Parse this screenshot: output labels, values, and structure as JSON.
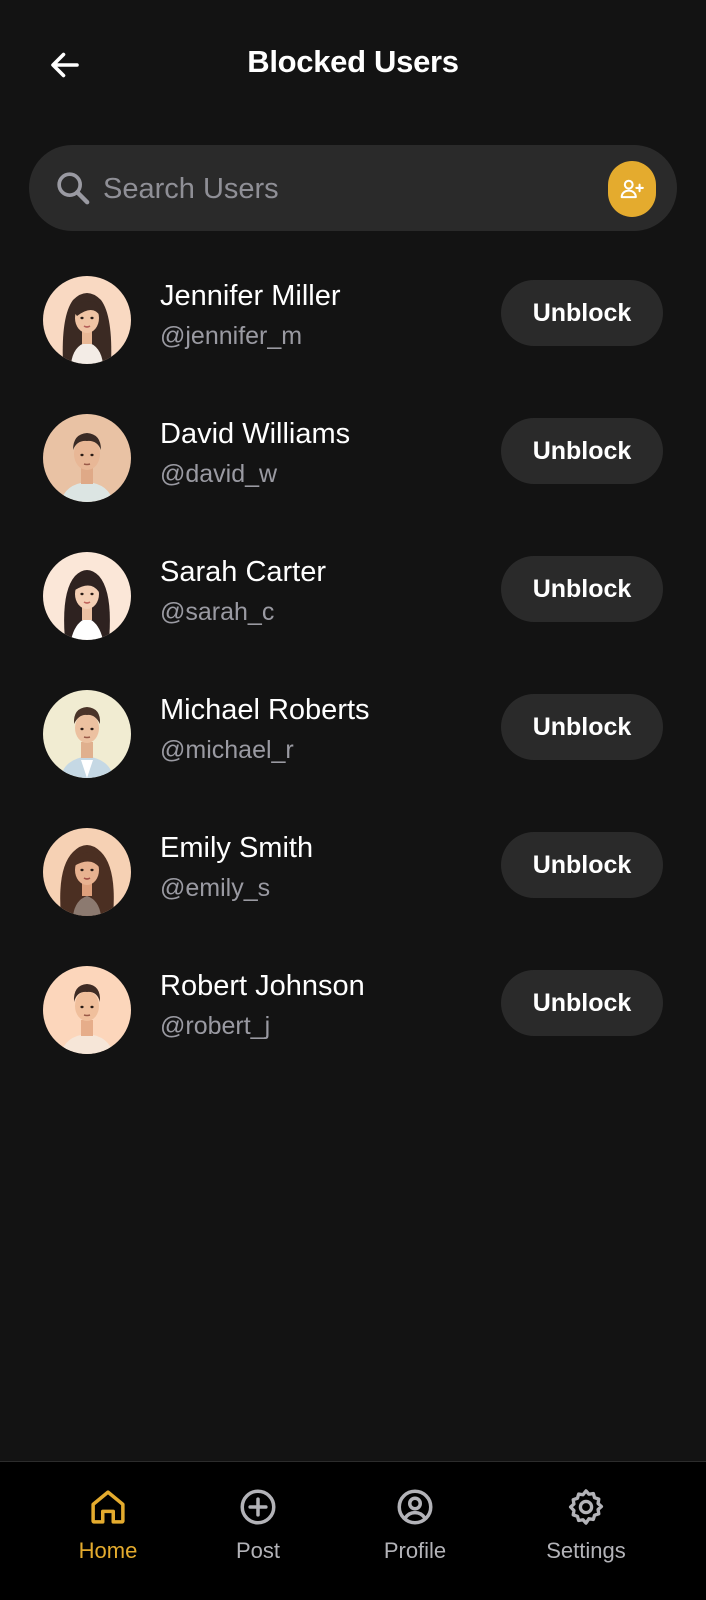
{
  "header": {
    "title": "Blocked Users",
    "back_icon": "arrow-left-icon"
  },
  "search": {
    "placeholder": "Search Users",
    "value": "",
    "icon": "search-icon",
    "action_icon": "add-user-icon"
  },
  "users": [
    {
      "name": "Jennifer Miller",
      "handle": "@jennifer_m",
      "button": "Unblock",
      "avatar": "female-avatar"
    },
    {
      "name": "David Williams",
      "handle": "@david_w",
      "button": "Unblock",
      "avatar": "male-avatar"
    },
    {
      "name": "Sarah Carter",
      "handle": "@sarah_c",
      "button": "Unblock",
      "avatar": "female-avatar"
    },
    {
      "name": "Michael Roberts",
      "handle": "@michael_r",
      "button": "Unblock",
      "avatar": "male-avatar"
    },
    {
      "name": "Emily Smith",
      "handle": "@emily_s",
      "button": "Unblock",
      "avatar": "female-avatar"
    },
    {
      "name": "Robert Johnson",
      "handle": "@robert_j",
      "button": "Unblock",
      "avatar": "male-avatar"
    }
  ],
  "nav": {
    "items": [
      {
        "label": "Home",
        "icon": "home-icon",
        "active": true
      },
      {
        "label": "Post",
        "icon": "plus-circle-icon",
        "active": false
      },
      {
        "label": "Profile",
        "icon": "user-circle-icon",
        "active": false
      },
      {
        "label": "Settings",
        "icon": "gear-icon",
        "active": false
      }
    ]
  },
  "colors": {
    "background": "#131313",
    "surface": "#2a2a2a",
    "accent": "#e4ab2e",
    "muted_text": "#9a9aa2",
    "nav_background": "#000000"
  }
}
